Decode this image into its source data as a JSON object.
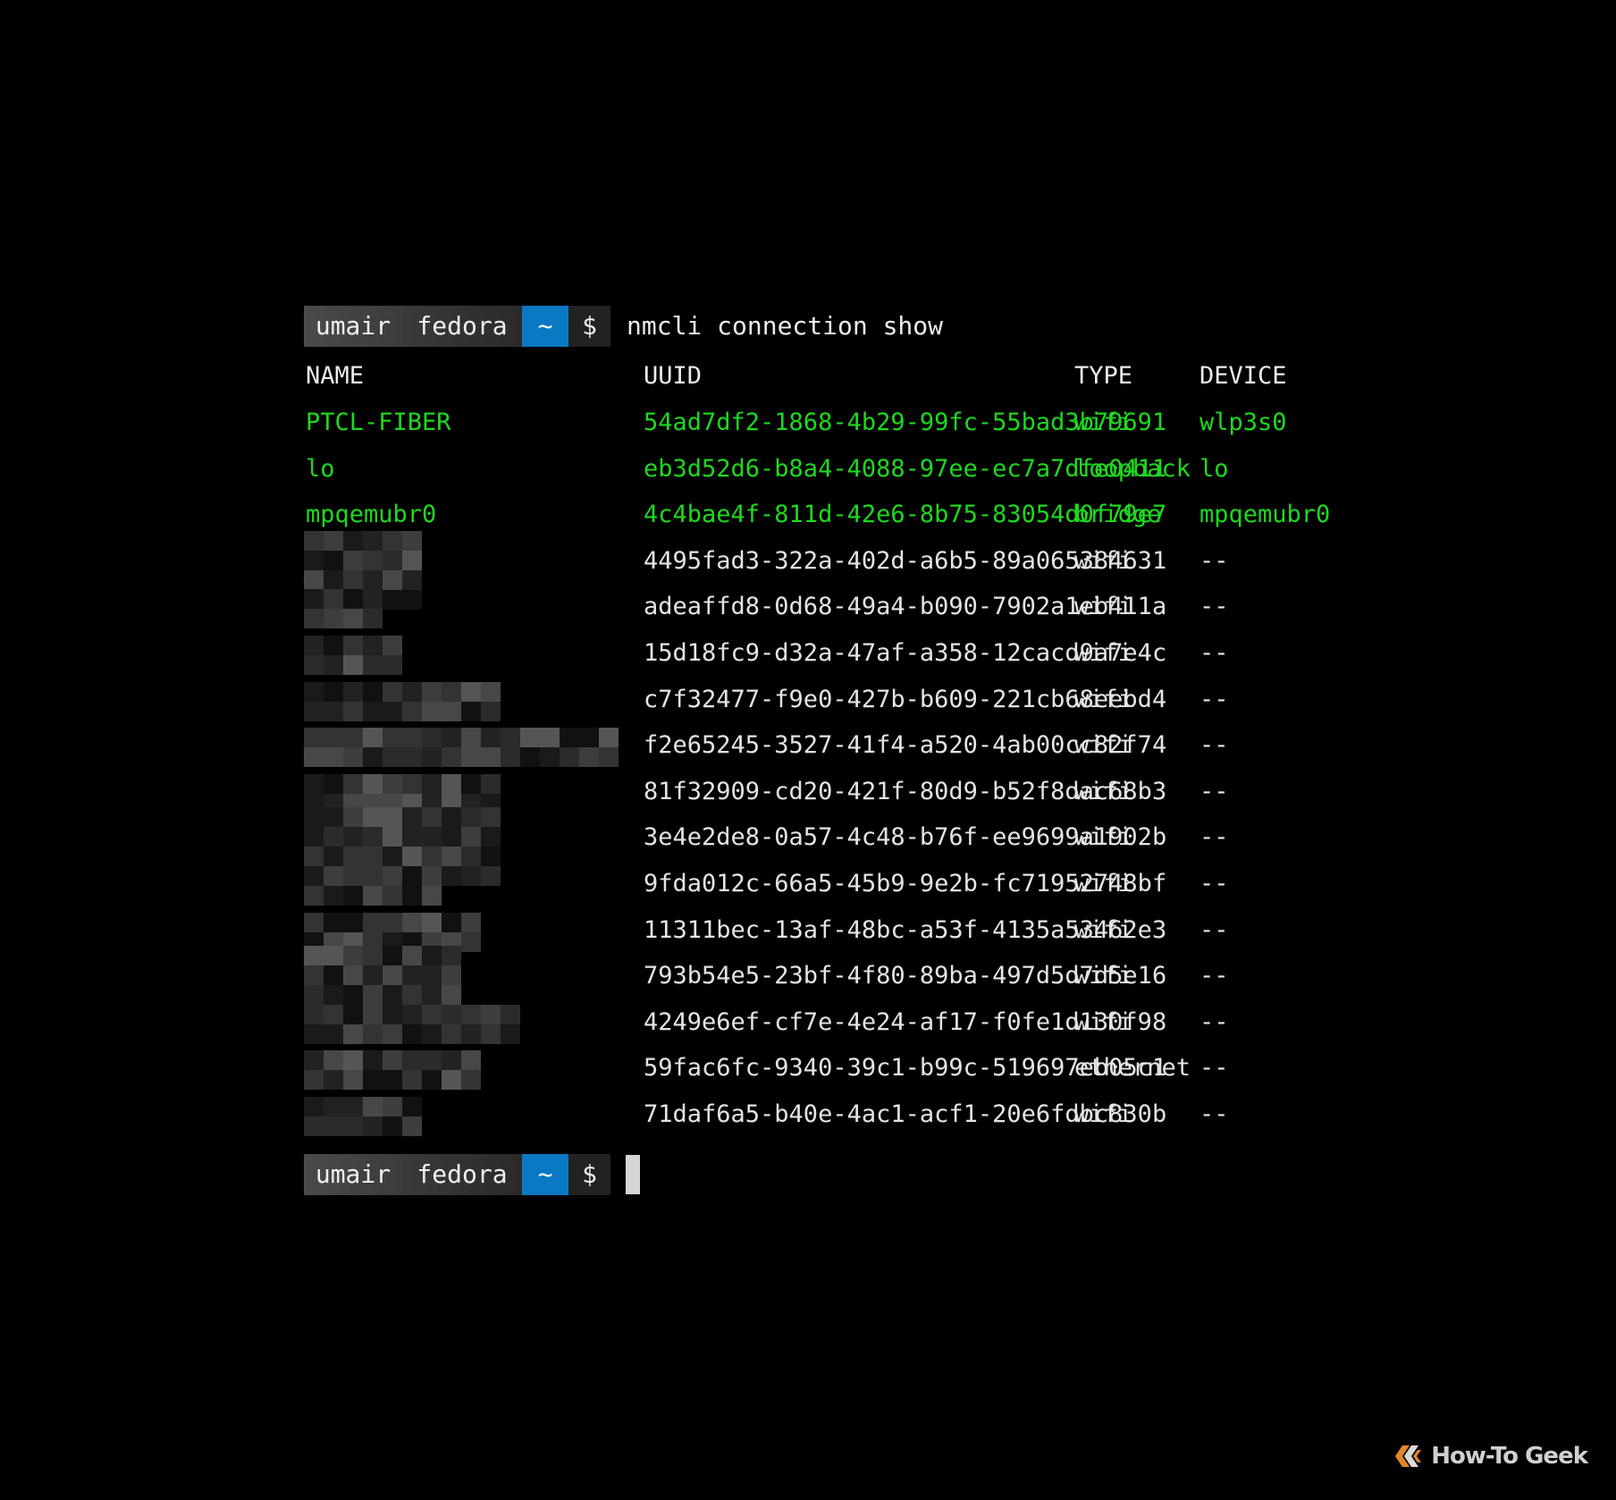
{
  "prompt": {
    "user": "umair",
    "host": "fedora",
    "dir": "~",
    "symbol": "$",
    "command": "nmcli connection show"
  },
  "table": {
    "headers": {
      "name": "NAME",
      "uuid": "UUID",
      "type": "TYPE",
      "device": "DEVICE"
    },
    "rows": [
      {
        "name": "PTCL-FIBER",
        "uuid": "54ad7df2-1868-4b29-99fc-55bad3b79691",
        "type": "wifi",
        "device": "wlp3s0",
        "active": true
      },
      {
        "name": "lo",
        "uuid": "eb3d52d6-b8a4-4088-97ee-ec7a7dfe0411",
        "type": "loopback",
        "device": "lo",
        "active": true
      },
      {
        "name": "mpqemubr0",
        "uuid": "4c4bae4f-811d-42e6-8b75-83054d0f79e7",
        "type": "bridge",
        "device": "mpqemubr0",
        "active": true
      },
      {
        "name": "",
        "uuid": "4495fad3-322a-402d-a6b5-89a065384631",
        "type": "wifi",
        "device": "--",
        "active": false
      },
      {
        "name": "",
        "uuid": "adeaffd8-0d68-49a4-b090-7902a1eb411a",
        "type": "wifi",
        "device": "--",
        "active": false
      },
      {
        "name": "",
        "uuid": "15d18fc9-d32a-47af-a358-12cacd9a7e4c",
        "type": "wifi",
        "device": "--",
        "active": false
      },
      {
        "name": "",
        "uuid": "c7f32477-f9e0-427b-b609-221cb68eebd4",
        "type": "wifi",
        "device": "--",
        "active": false
      },
      {
        "name": "",
        "uuid": "f2e65245-3527-41f4-a520-4ab00cc82f74",
        "type": "wifi",
        "device": "--",
        "active": false
      },
      {
        "name": "",
        "uuid": "81f32909-cd20-421f-80d9-b52f8dac68b3",
        "type": "wifi",
        "device": "--",
        "active": false
      },
      {
        "name": "",
        "uuid": "3e4e2de8-0a57-4c48-b76f-ee9699a1902b",
        "type": "wifi",
        "device": "--",
        "active": false
      },
      {
        "name": "",
        "uuid": "9fda012c-66a5-45b9-9e2b-fc71952748bf",
        "type": "wifi",
        "device": "--",
        "active": false
      },
      {
        "name": "",
        "uuid": "11311bec-13af-48bc-a53f-4135a53462e3",
        "type": "wifi",
        "device": "--",
        "active": false
      },
      {
        "name": "",
        "uuid": "793b54e5-23bf-4f80-89ba-497d5d7d5e16",
        "type": "wifi",
        "device": "--",
        "active": false
      },
      {
        "name": "",
        "uuid": "4249e6ef-cf7e-4e24-af17-f0fe1d130f98",
        "type": "wifi",
        "device": "--",
        "active": false
      },
      {
        "name": "",
        "uuid": "59fac6fc-9340-39c1-b99c-519697eb05c1",
        "type": "ethernet",
        "device": "--",
        "active": false
      },
      {
        "name": "",
        "uuid": "71daf6a5-b40e-4ac1-acf1-20e6fdbc830b",
        "type": "wifi",
        "device": "--",
        "active": false
      }
    ]
  },
  "colors": {
    "background": "#000000",
    "active_row": "#1ed81e",
    "dir_segment": "#0a78c2",
    "text": "#e4e4e4"
  },
  "watermark": {
    "text": "How-To Geek",
    "icon": "htg-logo-icon"
  }
}
